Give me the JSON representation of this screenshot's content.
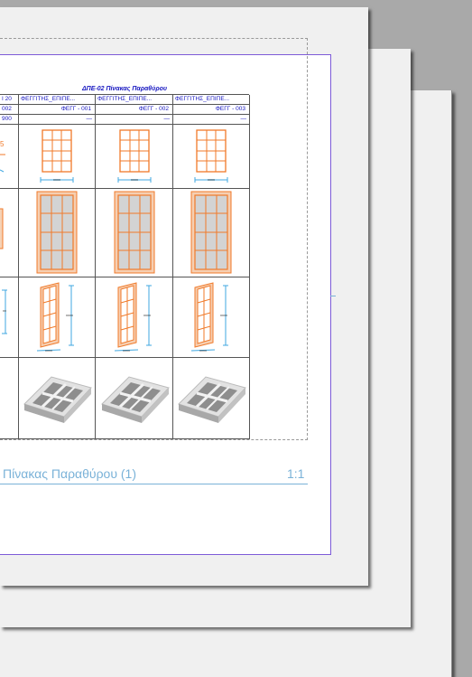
{
  "schedule": {
    "title": "ΔΠΕ-02 Πίνακας Παραθύρου",
    "partial_cells": {
      "header": "I 20",
      "id": "002",
      "size": "900",
      "dim_mark": "5"
    },
    "columns": [
      {
        "header": "ΦΕΓΓΙΤΗΣ_ΕΠΙΠΕ...",
        "id": "ΦΕΓΓ - 001",
        "value": "—"
      },
      {
        "header": "ΦΕΓΓΙΤΗΣ_ΕΠΙΠΕ...",
        "id": "ΦΕΓΓ - 002",
        "value": "—"
      },
      {
        "header": "ΦΕΓΓΙΤΗΣ_ΕΠΙΠΕ...",
        "id": "ΦΕΓΓ - 003",
        "value": "—"
      }
    ],
    "dim_label": "xxxx"
  },
  "footer": {
    "title": "Πίνακας Παραθύρου (1)",
    "scale": "1:1"
  },
  "colors": {
    "text_blue": "#1515c0",
    "window_orange": "#f07a2a",
    "dimension_blue": "#3fa7e0",
    "footer_blue": "#7ab2d8",
    "page_border": "#7d5bd8"
  },
  "icons": [
    "window-elevation-icon",
    "window-section-icon",
    "window-axonometric-icon",
    "window-3d-render-icon"
  ]
}
